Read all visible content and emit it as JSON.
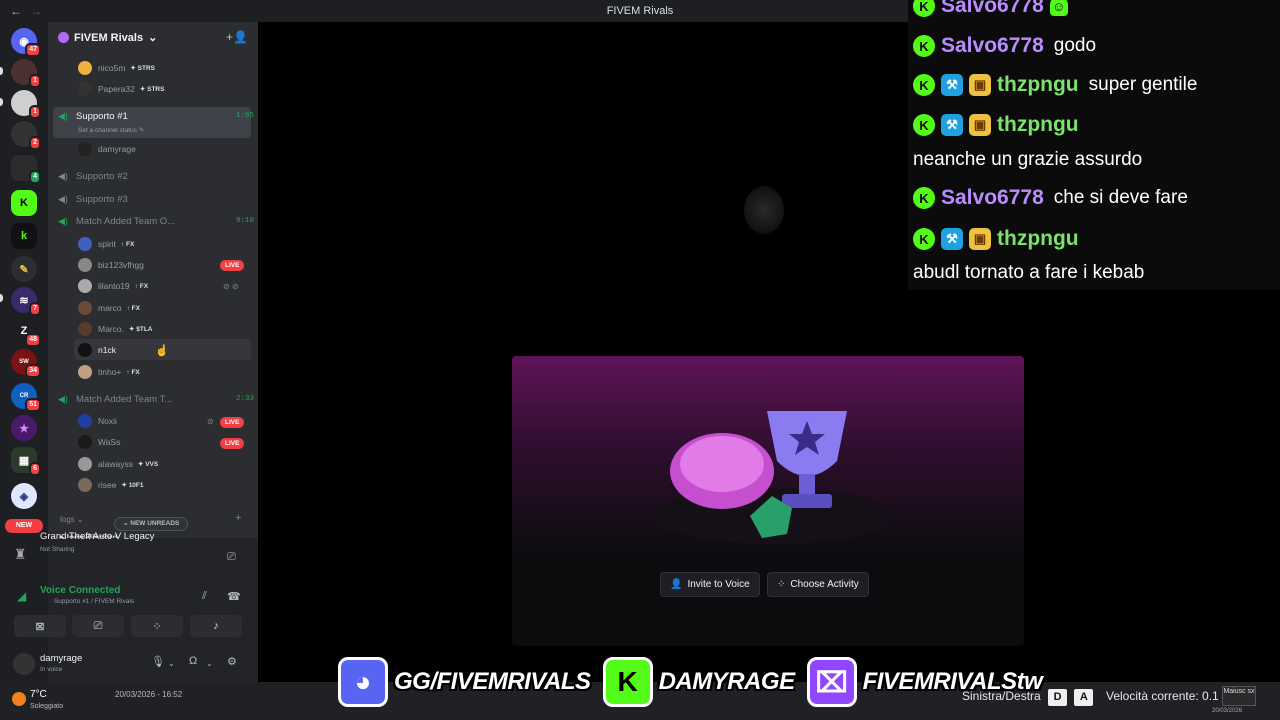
{
  "window": {
    "title": "FIVEM Rivals",
    "back_label": "←",
    "fwd_label": "→",
    "controls": [
      "▣",
      "?",
      "—",
      "☐",
      "✕"
    ]
  },
  "rail": {
    "badges": [
      "47",
      "1",
      "1",
      "2",
      "4",
      "7",
      "48",
      "34",
      "51",
      "6"
    ],
    "new_label": "NEW"
  },
  "server": {
    "name": "FIVEM Rivals",
    "chevron": "⌄",
    "add_icon": "+👤"
  },
  "voice": {
    "top_members": [
      {
        "name": "nico5m",
        "tag": "✦ STRS"
      },
      {
        "name": "Papera32",
        "tag": "✦ STRS"
      }
    ],
    "channels": {
      "support1": {
        "name": "Supporto #1",
        "time": "1:05",
        "status": "Set a channel status ✎"
      },
      "support1_members": [
        {
          "name": "damyrage"
        }
      ],
      "support2": {
        "name": "Supporto #2"
      },
      "support3": {
        "name": "Supporto #3"
      },
      "match1": {
        "name": "Match Added Team O...",
        "time": "9:10"
      },
      "match1_members": [
        {
          "name": "spirit",
          "tag": "↑ FX",
          "live": "LIVE"
        },
        {
          "name": "biz123vfhgg"
        },
        {
          "name": "lilanto19",
          "tag": "↑ FX"
        },
        {
          "name": "marco",
          "tag": "↑ FX"
        },
        {
          "name": "Marco.",
          "tag": "✦ $TLA"
        },
        {
          "name": "n1ck"
        },
        {
          "name": "tinho+",
          "tag": "↑ FX"
        }
      ],
      "match2": {
        "name": "Match Added Team T...",
        "time": "2:33"
      },
      "match2_members": [
        {
          "name": "Noxii",
          "live": "LIVE"
        },
        {
          "name": "WaSs",
          "live": "LIVE"
        },
        {
          "name": "alawayss",
          "tag": "✦ VVS"
        },
        {
          "name": "risee",
          "tag": "✦ 10F1"
        }
      ]
    },
    "logs_label": "logs ⌄",
    "new_unreads": "⌄ NEW UNREADS",
    "logs_discord": "▸ logs-discord"
  },
  "activity": {
    "game": "Grand Theft Auto V Legacy",
    "sharing": "Not Sharing"
  },
  "connection": {
    "title": "Voice Connected",
    "sub": "· Supporto #1 / FIVEM Rivals"
  },
  "user": {
    "name": "damyrage",
    "status": "In voice"
  },
  "stage": {
    "invite_label": "Invite to Voice",
    "activity_label": "Choose Activity"
  },
  "chat": [
    {
      "user": "Salvo6778",
      "color": "#b98cff",
      "text": "",
      "badges": [
        "K"
      ]
    },
    {
      "user": "Salvo6778",
      "color": "#b98cff",
      "text": "godo",
      "badges": [
        "K"
      ]
    },
    {
      "user": "thzpngu",
      "color": "#7be36b",
      "text": "super gentile",
      "badges": [
        "K",
        "hammer",
        "gift"
      ]
    },
    {
      "user": "thzpngu",
      "color": "#7be36b",
      "text": "",
      "badges": [
        "K",
        "hammer",
        "gift"
      ],
      "line2": "neanche un grazie assurdo"
    },
    {
      "user": "Salvo6778",
      "color": "#b98cff",
      "text": "che si deve fare",
      "badges": [
        "K"
      ]
    },
    {
      "user": "thzpngu",
      "color": "#7be36b",
      "text": "",
      "badges": [
        "K",
        "hammer",
        "gift"
      ],
      "line2": "abudl tornato a fare i kebab"
    }
  ],
  "banner": {
    "discord": "GG/FIVEMRIVALS",
    "kick": "DAMYRAGE",
    "twitch": "FIVEMRIVALStw"
  },
  "taskbar": {
    "temp": "7°C",
    "weather": "Soleggiato",
    "date": "20/03/2026 - 16:52",
    "hint_label": "Sinistra/Destra",
    "key1": "D",
    "key2": "A",
    "speed_label": "Velocità corrente: 0.1",
    "caps_label": "Maiusc sx",
    "date2": "20/03/2026"
  },
  "colors": {
    "accent_green": "#23a55a",
    "live_red": "#f23f43",
    "kick_green": "#53fc18",
    "twitch_purple": "#9146ff",
    "discord_blurple": "#5865f2"
  }
}
